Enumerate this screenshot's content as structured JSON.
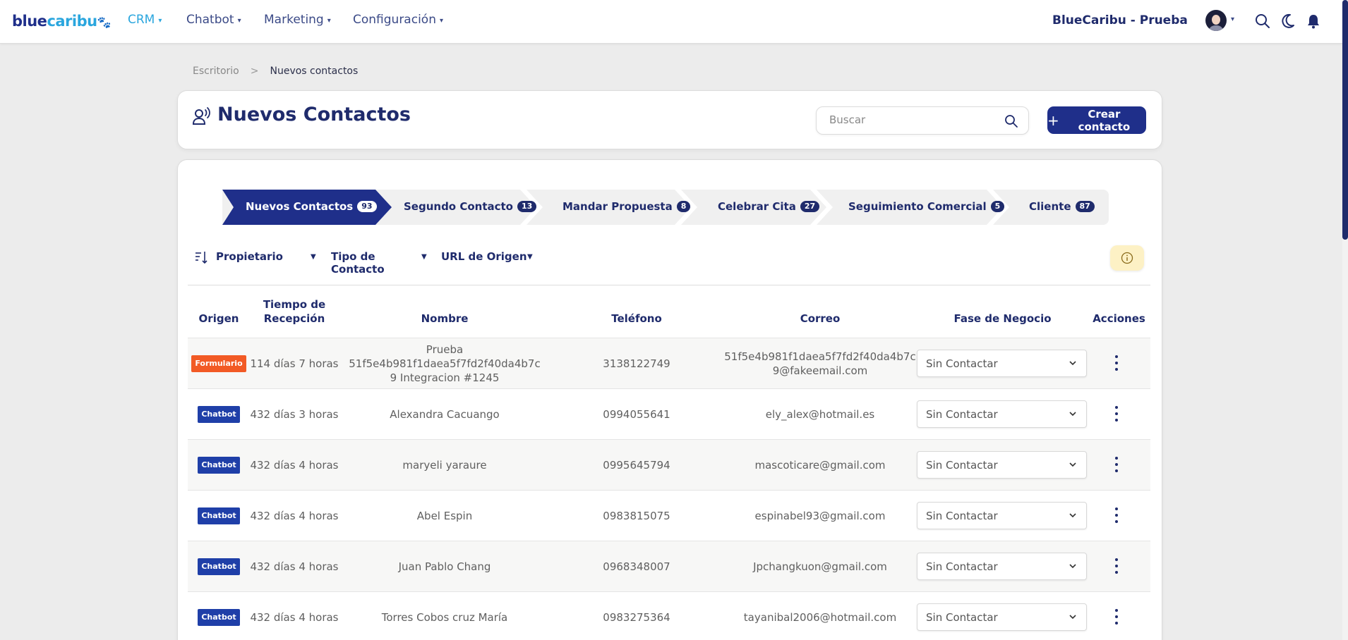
{
  "brand": {
    "part1": "blue",
    "part2": "caribu",
    "paw": "🐾"
  },
  "nav": [
    {
      "label": "CRM",
      "active": true
    },
    {
      "label": "Chatbot",
      "active": false
    },
    {
      "label": "Marketing",
      "active": false
    },
    {
      "label": "Configuración",
      "active": false
    }
  ],
  "account": {
    "company": "BlueCaribu - Prueba"
  },
  "icons": {
    "search": "search-icon",
    "theme": "moon-icon",
    "notifications": "bell-icon",
    "contact": "contact-voice-icon",
    "sort": "sort-icon",
    "info": "info-icon",
    "more": "kebab-icon"
  },
  "colors": {
    "primary": "#1f2f8a",
    "accent": "#2aa6de",
    "formulario": "#f25a25",
    "chatbot": "#1f3fa8",
    "info_bg": "#fdf1c5"
  },
  "breadcrumb": {
    "home": "Escritorio",
    "separator": ">",
    "current": "Nuevos contactos"
  },
  "header": {
    "title": "Nuevos Contactos",
    "search_placeholder": "Buscar",
    "create_plus": "+",
    "create_label": "Crear contacto"
  },
  "stages": [
    {
      "label": "Nuevos Contactos",
      "count": "93",
      "active": true
    },
    {
      "label": "Segundo Contacto",
      "count": "13",
      "active": false
    },
    {
      "label": "Mandar Propuesta",
      "count": "8",
      "active": false
    },
    {
      "label": "Celebrar Cita",
      "count": "27",
      "active": false
    },
    {
      "label": "Seguimiento Comercial",
      "count": "5",
      "active": false
    },
    {
      "label": "Cliente",
      "count": "87",
      "active": false
    }
  ],
  "filters": {
    "owner": "Propietario",
    "contact_type": "Tipo de Contacto",
    "origin_url": "URL de Origen"
  },
  "table": {
    "headers": {
      "origin": "Origen",
      "time_line1": "Tiempo de",
      "time_line2": "Recepción",
      "name": "Nombre",
      "phone": "Teléfono",
      "email": "Correo",
      "stage": "Fase de Negocio",
      "actions": "Acciones"
    },
    "rows": [
      {
        "origin": "Formulario",
        "time": "114 días 7 horas",
        "name_line1": "Prueba 51f5e4b981f1daea5f7fd2f40da4b7c",
        "name_line2": "9 Integracion #1245",
        "phone": "3138122749",
        "email_line1": "51f5e4b981f1daea5f7fd2f40da4b7c",
        "email_line2": "9@fakeemail.com",
        "stage": "Sin Contactar"
      },
      {
        "origin": "Chatbot",
        "time": "432 días 3 horas",
        "name_line1": "Alexandra Cacuango",
        "phone": "0994055641",
        "email_line1": "ely_alex@hotmail.es",
        "stage": "Sin Contactar"
      },
      {
        "origin": "Chatbot",
        "time": "432 días 4 horas",
        "name_line1": "maryeli yaraure",
        "phone": "0995645794",
        "email_line1": "mascoticare@gmail.com",
        "stage": "Sin Contactar"
      },
      {
        "origin": "Chatbot",
        "time": "432 días 4 horas",
        "name_line1": "Abel Espin",
        "phone": "0983815075",
        "email_line1": "espinabel93@gmail.com",
        "stage": "Sin Contactar"
      },
      {
        "origin": "Chatbot",
        "time": "432 días 4 horas",
        "name_line1": "Juan Pablo Chang",
        "phone": "0968348007",
        "email_line1": "Jpchangkuon@gmail.com",
        "stage": "Sin Contactar"
      },
      {
        "origin": "Chatbot",
        "time": "432 días 4 horas",
        "name_line1": "Torres Cobos cruz María",
        "phone": "0983275364",
        "email_line1": "tayanibal2006@hotmail.com",
        "stage": "Sin Contactar"
      }
    ]
  }
}
